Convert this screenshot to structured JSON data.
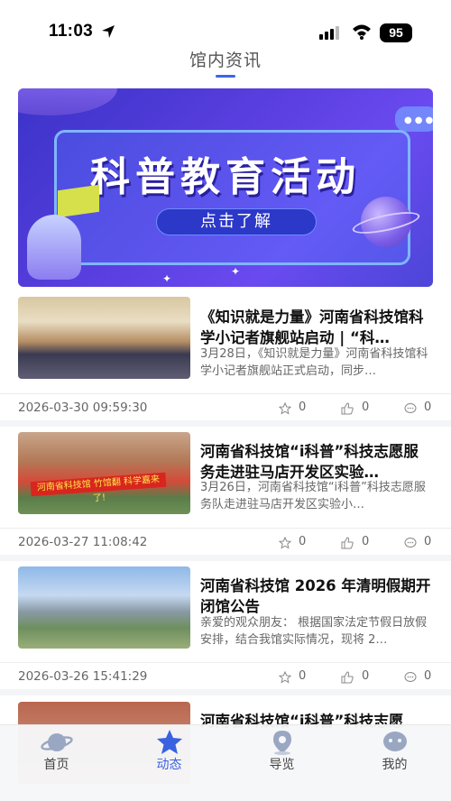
{
  "status_bar": {
    "time": "11:03",
    "battery": "95"
  },
  "header": {
    "title": "馆内资讯"
  },
  "banner": {
    "title": "科普教育活动",
    "button_label": "点击了解"
  },
  "news": [
    {
      "title": "《知识就是力量》河南省科技馆科学小记者旗舰站启动 | “科…",
      "summary": "3月28日，《知识就是力量》河南省科技馆科学小记者旗舰站正式启动，同步…",
      "date": "2026-03-30 09:59:30",
      "favorites": "0",
      "likes": "0",
      "comments": "0"
    },
    {
      "title": "河南省科技馆“i科普”科技志愿服务走进驻马店开发区实验…",
      "summary": "3月26日，河南省科技馆“i科普”科技志愿服务队走进驻马店开发区实验小…",
      "thumb_banner": "河南省科技馆  竹馆翻  科学嘉来了!",
      "date": "2026-03-27 11:08:42",
      "favorites": "0",
      "likes": "0",
      "comments": "0"
    },
    {
      "title": "河南省科技馆 2026 年清明假期开闭馆公告",
      "summary": "亲爱的观众朋友：  根据国家法定节假日放假安排，结合我馆实际情况，现将 2…",
      "date": "2026-03-26 15:41:29",
      "favorites": "0",
      "likes": "0",
      "comments": "0"
    },
    {
      "title": "河南省科技馆“i科普”科技志愿"
    }
  ],
  "tabs": [
    {
      "label": "首页",
      "icon": "planet-icon",
      "active": false
    },
    {
      "label": "动态",
      "icon": "star-icon",
      "active": true
    },
    {
      "label": "导览",
      "icon": "location-pin-icon",
      "active": false
    },
    {
      "label": "我的",
      "icon": "chat-face-icon",
      "active": false
    }
  ],
  "colors": {
    "accent": "#3a62e0",
    "banner_bg": "#5b3fe0",
    "separator": "#ececec"
  }
}
